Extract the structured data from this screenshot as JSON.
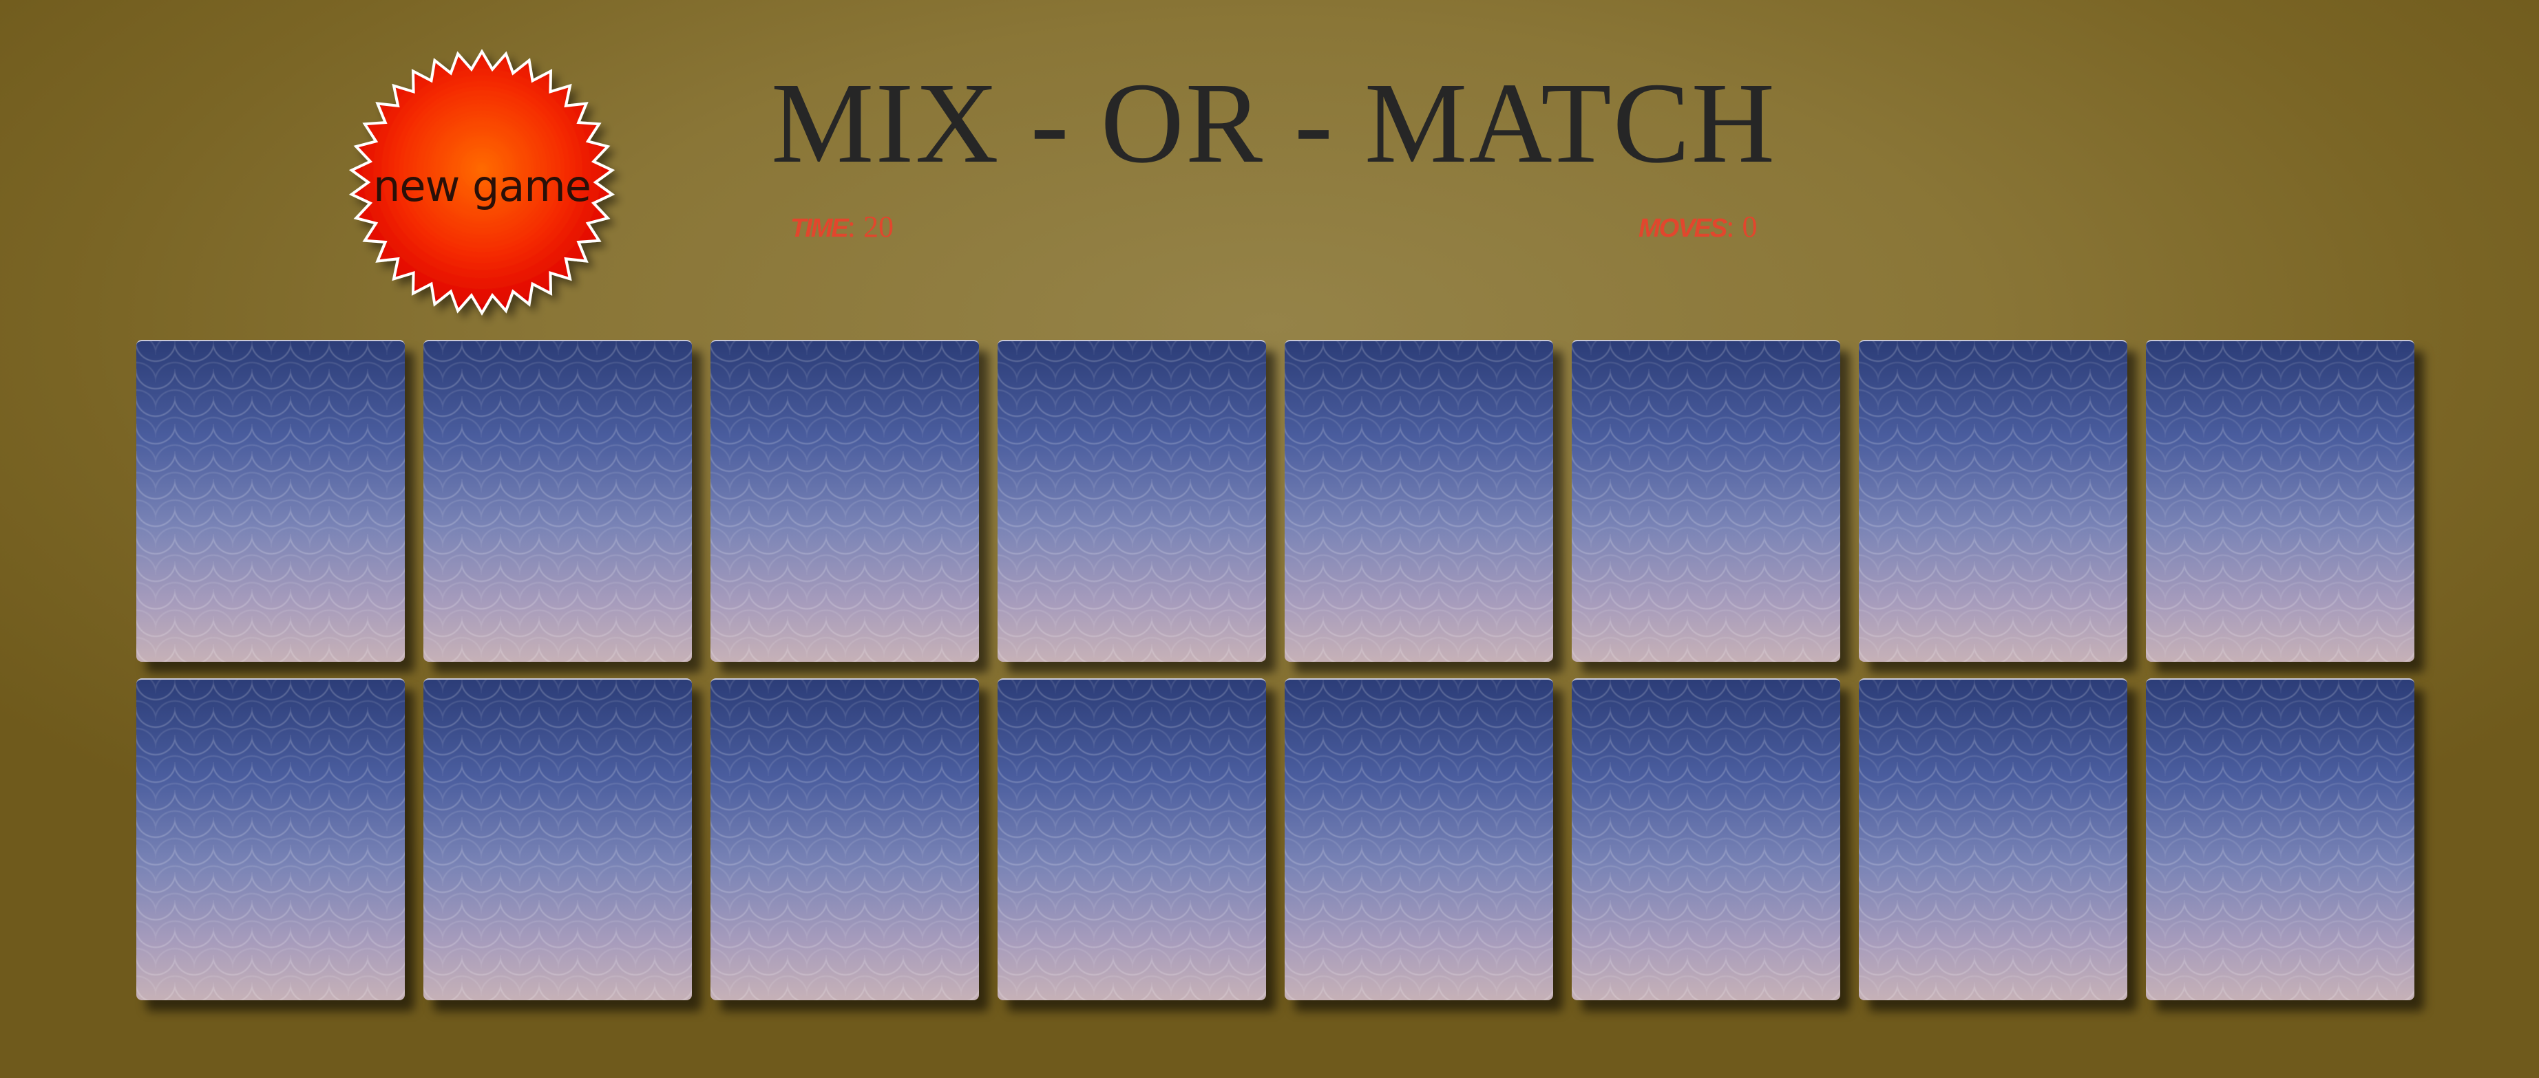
{
  "game": {
    "title": "MIX - OR - MATCH",
    "new_game_label": "new game",
    "time_label": "Time",
    "time_value": "20",
    "moves_label": "Moves",
    "moves_value": "0"
  },
  "colors": {
    "background": "#8a7637",
    "title": "#262626",
    "stats": "#e2462d",
    "burst_center": "#ff5a00",
    "burst_edge": "#e80000",
    "card_top": "#2c3d78",
    "card_bottom": "#c6b1b7"
  },
  "cards": {
    "count": 16,
    "rows": 2,
    "columns": 8,
    "state": "face-down"
  }
}
